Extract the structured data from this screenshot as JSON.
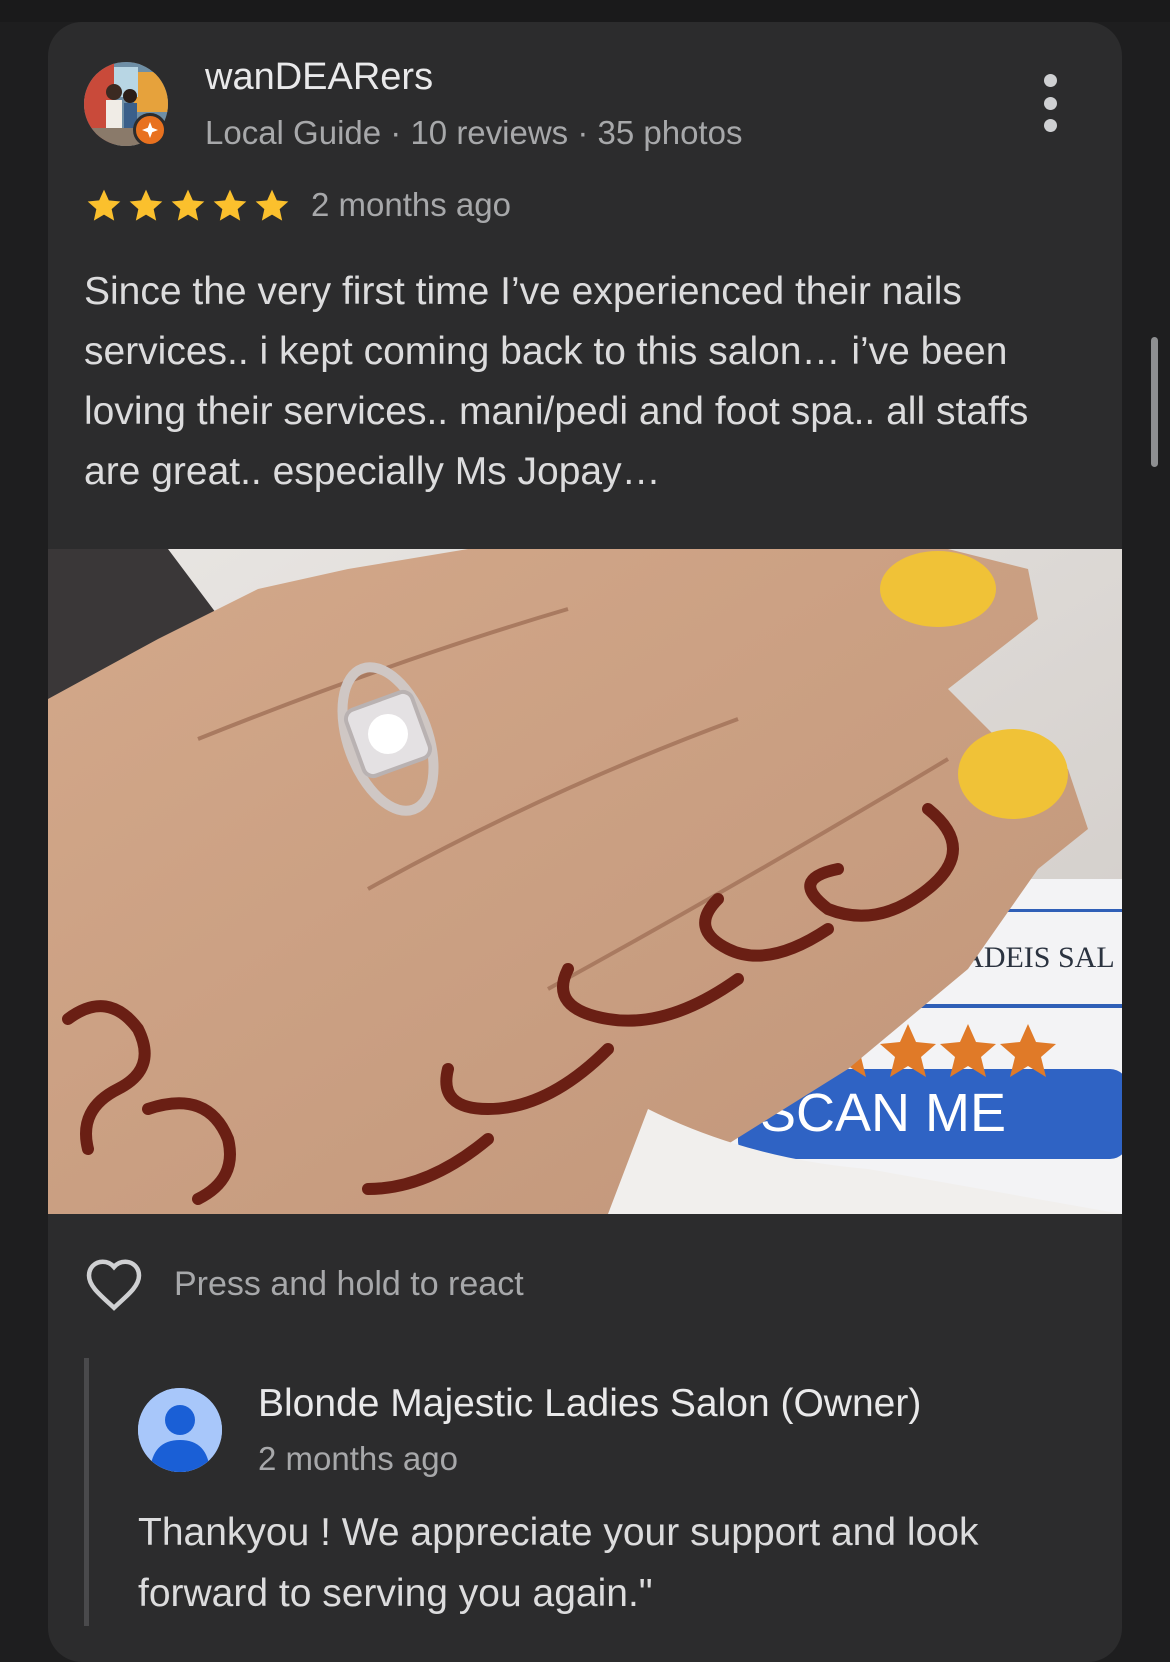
{
  "review": {
    "user_name": "wanDEARers",
    "user_meta": "Local Guide · 10 reviews · 35 photos",
    "rating": 5,
    "rating_max": 5,
    "time": "2 months ago",
    "text": "Since the very first time I’ve experienced their nails services.. i kept coming back to this salon… i’ve been loving their services.. mani/pedi and foot spa.. all staffs are great.. especially Ms Jopay…",
    "photo": {
      "sign_text": "TIC LADEIS SAL",
      "sign_button": "SCAN ME"
    }
  },
  "reaction": {
    "label": "Press and hold to react"
  },
  "owner_reply": {
    "name": "Blonde Majestic Ladies Salon (Owner)",
    "time": "2 months ago",
    "text": "Thankyou ! We appreciate your support and look forward to serving you again.\""
  },
  "colors": {
    "background": "#1e1e1f",
    "card": "#2c2c2d",
    "star": "#fbc02d",
    "guide_badge": "#e8711f",
    "owner_avatar": "#a8c7fa"
  },
  "icons": {
    "more": "more-vert-icon",
    "star": "star-icon",
    "react": "heart-outline-icon",
    "owner": "person-icon",
    "guide": "local-guide-badge-icon"
  }
}
